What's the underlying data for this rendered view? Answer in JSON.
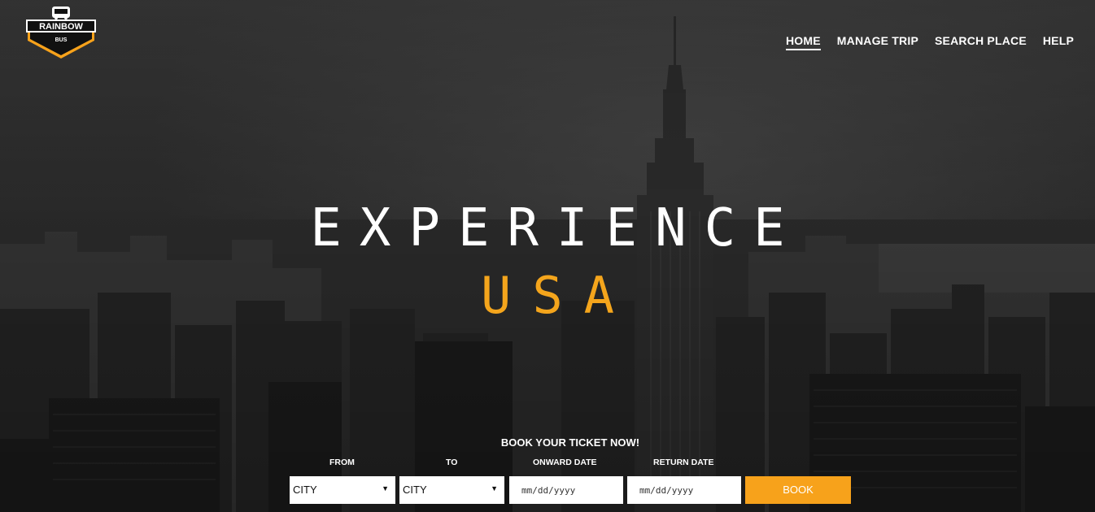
{
  "brand": {
    "name": "RAINBOW",
    "sub": "BUS",
    "accent": "#f7a21b"
  },
  "nav": {
    "items": [
      {
        "label": "HOME",
        "active": true
      },
      {
        "label": "MANAGE TRIP",
        "active": false
      },
      {
        "label": "SEARCH PLACE",
        "active": false
      },
      {
        "label": "HELP",
        "active": false
      }
    ]
  },
  "hero": {
    "line1": "EXPERIENCE",
    "line2": "USA",
    "line2_color": "#f4a51c"
  },
  "booking": {
    "title": "BOOK YOUR TICKET NOW!",
    "from_label": "FROM",
    "to_label": "TO",
    "onward_label": "ONWARD DATE",
    "return_label": "RETURN DATE",
    "from_value": "CITY",
    "to_value": "CITY",
    "onward_placeholder": "mm/dd/yyyy",
    "return_placeholder": "mm/dd/yyyy",
    "button": "BOOK"
  }
}
